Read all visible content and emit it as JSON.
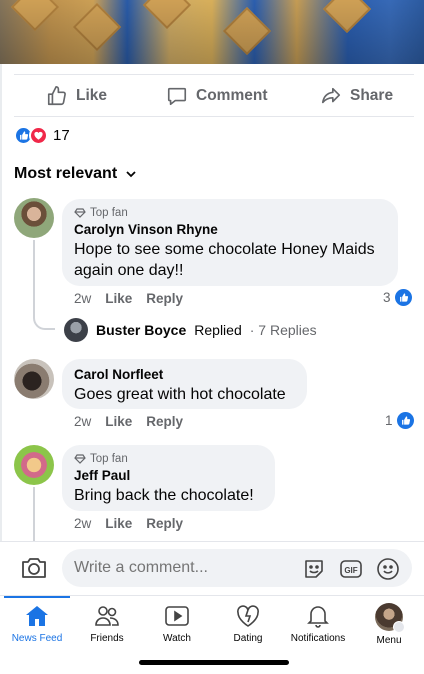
{
  "actions": {
    "like": "Like",
    "comment": "Comment",
    "share": "Share"
  },
  "reactions": {
    "count": "17"
  },
  "sort": {
    "label": "Most relevant"
  },
  "comments": [
    {
      "badge": "Top fan",
      "name": "Carolyn Vinson Rhyne",
      "text_line1": "Hope to see some chocolate Honey Maids",
      "text_line2": "again one day!!",
      "time": "2w",
      "like": "Like",
      "reply": "Reply",
      "likes": "3",
      "replies": {
        "name": "Buster Boyce",
        "action": "Replied",
        "count": "· 7 Replies"
      }
    },
    {
      "name": "Carol Norfleet",
      "text_line1": "Goes great with hot chocolate",
      "time": "2w",
      "like": "Like",
      "reply": "Reply",
      "likes": "1"
    },
    {
      "badge": "Top fan",
      "name": "Jeff Paul",
      "text_line1": "Bring back the chocolate!",
      "time": "2w",
      "like": "Like",
      "reply": "Reply"
    }
  ],
  "composer": {
    "placeholder": "Write a comment..."
  },
  "tabs": [
    {
      "label": "News Feed",
      "icon": "home-icon",
      "active": true
    },
    {
      "label": "Friends",
      "icon": "friends-icon"
    },
    {
      "label": "Watch",
      "icon": "watch-icon"
    },
    {
      "label": "Dating",
      "icon": "dating-heart-icon"
    },
    {
      "label": "Notifications",
      "icon": "bell-icon"
    },
    {
      "label": "Menu",
      "icon": "profile-avatar-icon"
    }
  ],
  "colors": {
    "accent": "#1b74e4",
    "love": "#f02849",
    "bubble": "#f0f2f5",
    "muted": "#65676b"
  }
}
